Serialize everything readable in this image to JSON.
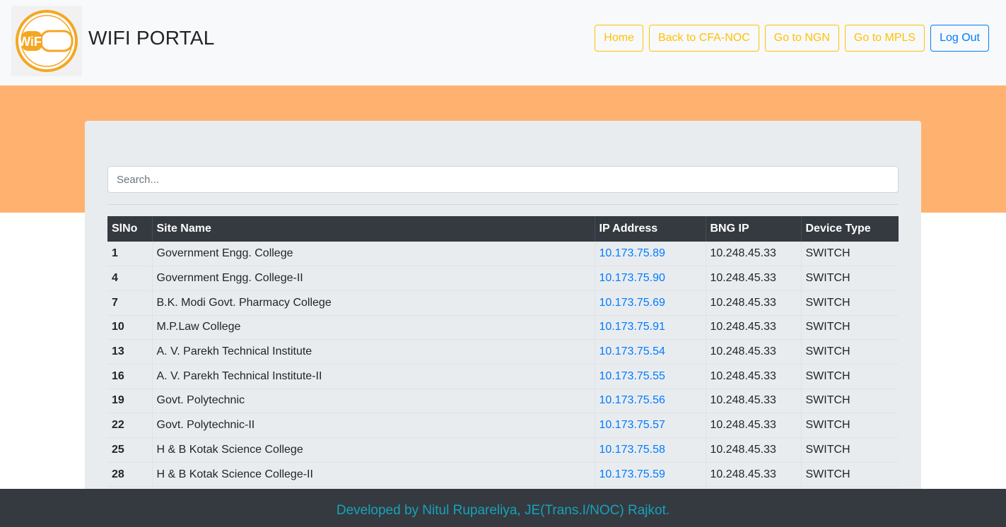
{
  "header": {
    "logo_text": "WiFi",
    "brand": "WIFI PORTAL",
    "nav": [
      {
        "label": "Home"
      },
      {
        "label": "Back to CFA-NOC"
      },
      {
        "label": "Go to NGN"
      },
      {
        "label": "Go to MPLS"
      },
      {
        "label": "Log Out"
      }
    ]
  },
  "search": {
    "placeholder": "Search..."
  },
  "table": {
    "columns": [
      "SlNo",
      "Site Name",
      "IP Address",
      "BNG IP",
      "Device Type"
    ],
    "rows": [
      {
        "sl": "1",
        "site": "Government Engg. College",
        "ip": "10.173.75.89",
        "bng": "10.248.45.33",
        "type": "SWITCH"
      },
      {
        "sl": "4",
        "site": "Government Engg. College-II",
        "ip": "10.173.75.90",
        "bng": "10.248.45.33",
        "type": "SWITCH"
      },
      {
        "sl": "7",
        "site": "B.K. Modi Govt. Pharmacy College",
        "ip": "10.173.75.69",
        "bng": "10.248.45.33",
        "type": "SWITCH"
      },
      {
        "sl": "10",
        "site": "M.P.Law College",
        "ip": "10.173.75.91",
        "bng": "10.248.45.33",
        "type": "SWITCH"
      },
      {
        "sl": "13",
        "site": "A. V. Parekh Technical Institute",
        "ip": "10.173.75.54",
        "bng": "10.248.45.33",
        "type": "SWITCH"
      },
      {
        "sl": "16",
        "site": "A. V. Parekh Technical Institute-II",
        "ip": "10.173.75.55",
        "bng": "10.248.45.33",
        "type": "SWITCH"
      },
      {
        "sl": "19",
        "site": "Govt. Polytechnic",
        "ip": "10.173.75.56",
        "bng": "10.248.45.33",
        "type": "SWITCH"
      },
      {
        "sl": "22",
        "site": "Govt. Polytechnic-II",
        "ip": "10.173.75.57",
        "bng": "10.248.45.33",
        "type": "SWITCH"
      },
      {
        "sl": "25",
        "site": "H & B Kotak Science College",
        "ip": "10.173.75.58",
        "bng": "10.248.45.33",
        "type": "SWITCH"
      },
      {
        "sl": "28",
        "site": "H & B Kotak Science College-II",
        "ip": "10.173.75.59",
        "bng": "10.248.45.33",
        "type": "SWITCH"
      }
    ]
  },
  "footer": {
    "text": "Developed by Nitul Rupareliya, JE(Trans.I/NOC) Rajkot."
  },
  "colors": {
    "banner": "#ffb26f",
    "warning": "#ffc107",
    "primary": "#007bff",
    "dark": "#343a40",
    "footer_text": "#17a2b8"
  }
}
